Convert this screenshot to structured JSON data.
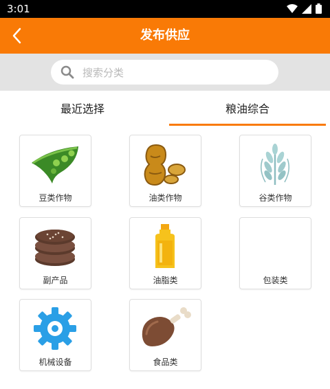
{
  "status_bar": {
    "time": "3:01"
  },
  "app_bar": {
    "title": "发布供应"
  },
  "search": {
    "placeholder": "搜索分类"
  },
  "tabs": [
    {
      "label": "最近选择",
      "active": false
    },
    {
      "label": "粮油综合",
      "active": true
    }
  ],
  "categories": [
    {
      "label": "豆类作物",
      "icon": "pea-pod-icon"
    },
    {
      "label": "油类作物",
      "icon": "peanut-icon"
    },
    {
      "label": "谷类作物",
      "icon": "wheat-icon"
    },
    {
      "label": "副产品",
      "icon": "cake-stack-icon"
    },
    {
      "label": "油脂类",
      "icon": "oil-bottle-icon"
    },
    {
      "label": "包装类",
      "icon": ""
    },
    {
      "label": "机械设备",
      "icon": "gear-icon"
    },
    {
      "label": "食品类",
      "icon": "drumstick-icon"
    }
  ],
  "colors": {
    "accent": "#f97a06",
    "search_band": "#e3e3e3"
  }
}
